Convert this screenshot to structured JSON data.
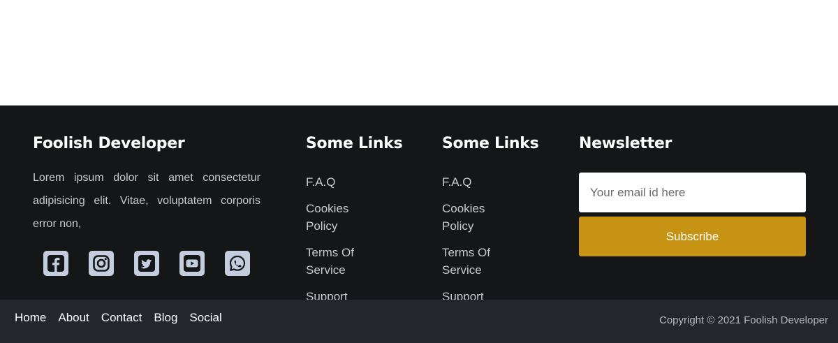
{
  "colors": {
    "footer_bg": "#151618",
    "bottom_bg": "#24252d",
    "accent": "#c69314",
    "social_icon_bg": "#c3cdde"
  },
  "footer": {
    "about": {
      "title": "Foolish Developer",
      "text": "Lorem ipsum dolor sit amet consectetur adipisicing elit. Vitae, voluptatem corporis error non,",
      "socials": [
        {
          "icon": "facebook-icon"
        },
        {
          "icon": "instagram-icon"
        },
        {
          "icon": "twitter-icon"
        },
        {
          "icon": "youtube-icon"
        },
        {
          "icon": "whatsapp-icon"
        }
      ]
    },
    "links1": {
      "title": "Some Links",
      "items": [
        "F.A.Q",
        "Cookies Policy",
        "Terms Of Service",
        "Support"
      ]
    },
    "links2": {
      "title": "Some Links",
      "items": [
        "F.A.Q",
        "Cookies Policy",
        "Terms Of Service",
        "Support"
      ]
    },
    "newsletter": {
      "title": "Newsletter",
      "email_placeholder": "Your email id here",
      "email_value": "",
      "button_label": "Subscribe"
    }
  },
  "bottom_bar": {
    "nav": [
      "Home",
      "About",
      "Contact",
      "Blog",
      "Social"
    ],
    "copyright": "Copyright © 2021 Foolish Developer"
  }
}
